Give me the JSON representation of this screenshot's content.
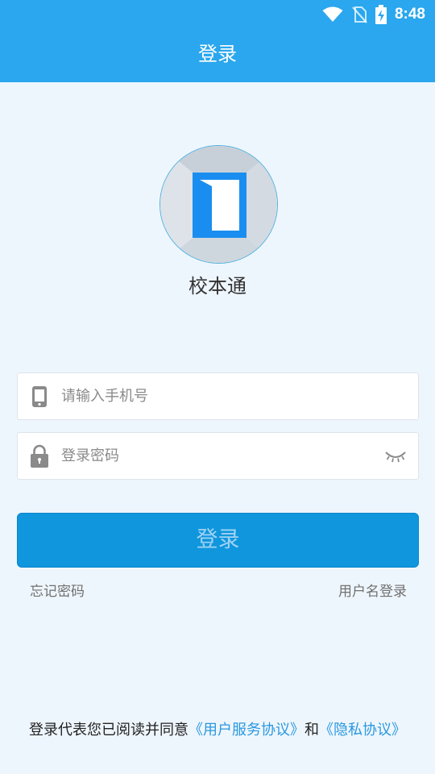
{
  "status_bar": {
    "time": "8:48",
    "icons": [
      "wifi-icon",
      "no-sim-icon",
      "battery-charging-icon"
    ]
  },
  "header": {
    "title": "登录",
    "color": "#2aa7ee"
  },
  "app": {
    "name": "校本通",
    "logo_icon": "door-logo-icon",
    "logo_color": "#1a8ef0"
  },
  "form": {
    "phone": {
      "placeholder": "请输入手机号",
      "value": "",
      "icon": "phone-icon"
    },
    "password": {
      "placeholder": "登录密码",
      "value": "",
      "icon": "lock-icon",
      "toggle_icon": "eye-closed-icon"
    },
    "login_button_label": "登录"
  },
  "links": {
    "forgot_password": "忘记密码",
    "username_login": "用户名登录"
  },
  "agreement": {
    "prefix": "登录代表您已阅读并同意",
    "user_agreement": "《用户服务协议》",
    "conjunction": "和",
    "privacy_policy": "《隐私协议》",
    "link_color": "#2a98e0"
  }
}
